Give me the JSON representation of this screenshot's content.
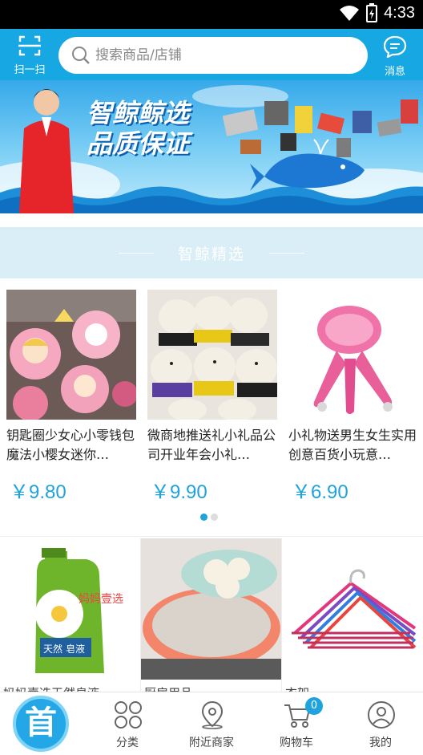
{
  "status": {
    "time": "4:33"
  },
  "header": {
    "scan_label": "扫一扫",
    "search_placeholder": "搜索商品/店铺",
    "message_label": "消息"
  },
  "banner": {
    "line1": "智鲸鲸选",
    "line2": "品质保证"
  },
  "section": {
    "title": "智鲸精选"
  },
  "featured": [
    {
      "name": "钥匙圈少女心小零钱包魔法小樱女迷你…",
      "price": "￥9.80"
    },
    {
      "name": "微商地推送礼小礼品公司开业年会小礼…",
      "price": "￥9.90"
    },
    {
      "name": "小礼物送男生女生实用创意百货小玩意…",
      "price": "￥6.90"
    }
  ],
  "carousel": {
    "pages": 2,
    "active": 1
  },
  "grid_products": [
    {
      "name": "妈妈壹选天然皂液",
      "bottle_brand": "妈妈壹选",
      "bottle_product": "皂液",
      "bottle_sub": "天然"
    },
    {
      "name": "厨房用品"
    },
    {
      "name": "衣架"
    }
  ],
  "tabbar": {
    "home": "首",
    "category": "分类",
    "nearby": "附近商家",
    "cart": "购物车",
    "cart_count": "0",
    "mine": "我的"
  },
  "colors": {
    "brand": "#17a8e3",
    "price": "#1ea3de",
    "section_bg": "#d9eef6"
  }
}
